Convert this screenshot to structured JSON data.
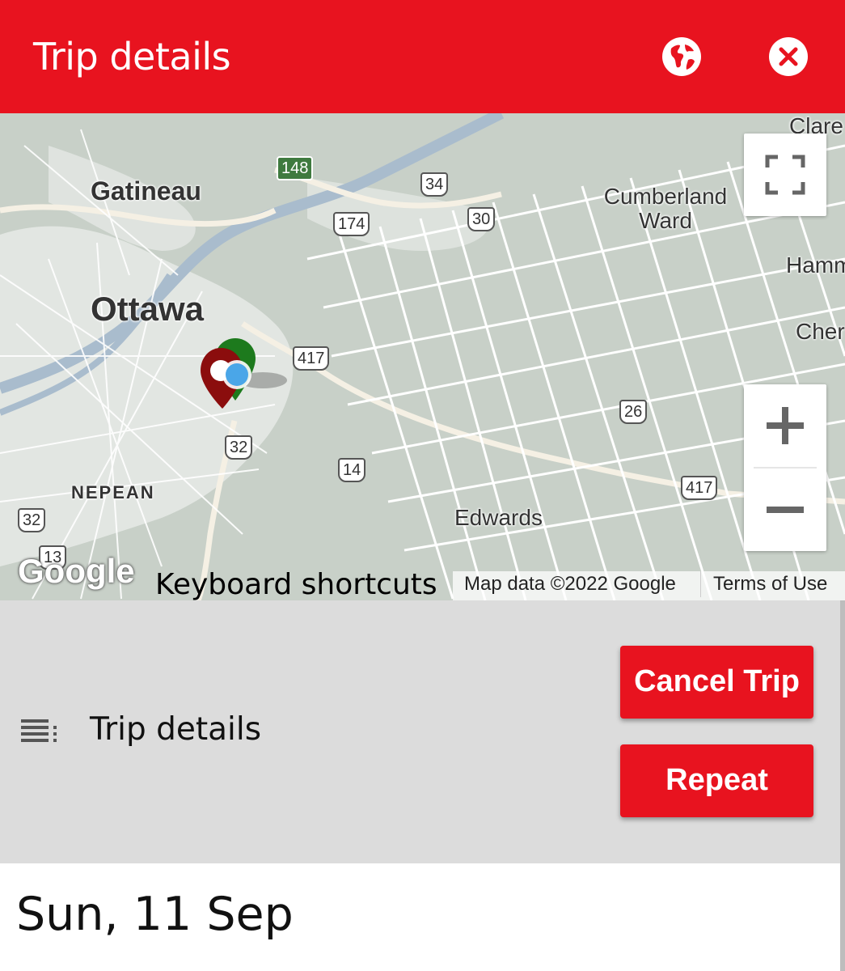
{
  "header": {
    "title": "Trip details",
    "globe_icon": "globe-icon",
    "close_icon": "close-icon",
    "color": "#e8131f"
  },
  "map": {
    "place_labels": [
      "Gatineau",
      "Ottawa",
      "Cumberland Ward",
      "NEPEAN",
      "Edwards",
      "Clare",
      "Hamm",
      "Cher"
    ],
    "road_shields": [
      "148",
      "34",
      "174",
      "30",
      "417",
      "26",
      "32",
      "14",
      "417",
      "32",
      "13"
    ],
    "fullscreen_icon": "fullscreen-icon",
    "zoom_in_icon": "plus-icon",
    "zoom_out_icon": "minus-icon",
    "google_logo": "Google",
    "keyboard_shortcuts": "Keyboard shortcuts",
    "map_data": "Map data ©2022 Google",
    "terms": "Terms of Use"
  },
  "details": {
    "list_icon": "list-icon",
    "title": "Trip details",
    "cancel_button": "Cancel Trip",
    "repeat_button": "Repeat"
  },
  "date": "Sun, 11 Sep"
}
